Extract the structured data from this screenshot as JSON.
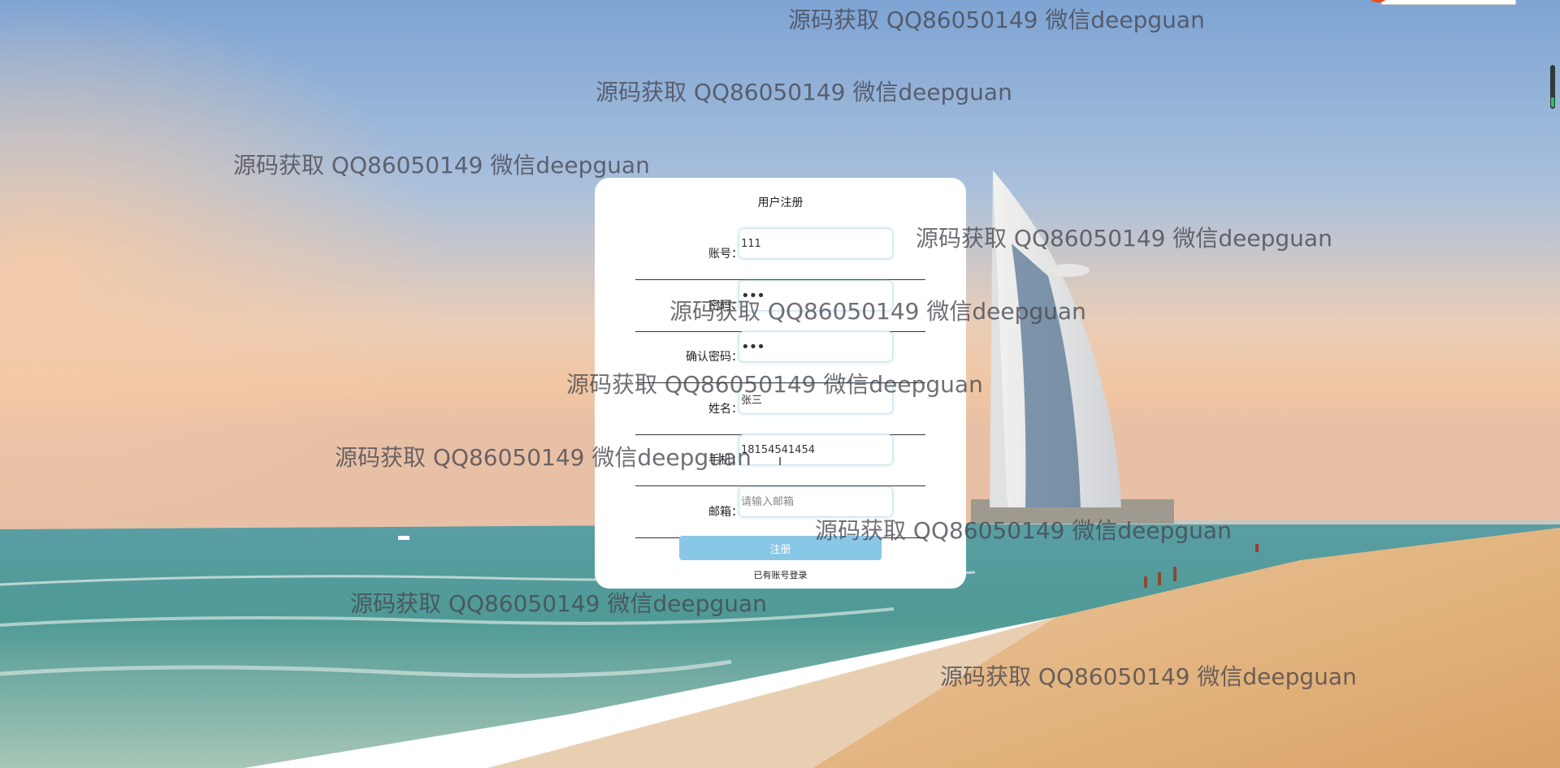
{
  "form": {
    "title": "用户注册",
    "fields": [
      {
        "label": "账号：",
        "value": "111",
        "placeholder": "",
        "type": "text"
      },
      {
        "label": "密码：",
        "value": "111",
        "placeholder": "",
        "type": "password"
      },
      {
        "label": "确认密码：",
        "value": "111",
        "placeholder": "",
        "type": "password"
      },
      {
        "label": "姓名：",
        "value": "张三",
        "placeholder": "",
        "type": "text"
      },
      {
        "label": "手机：",
        "value": "18154541454",
        "placeholder": "",
        "type": "text"
      },
      {
        "label": "邮箱：",
        "value": "",
        "placeholder": "请输入邮箱",
        "type": "text"
      }
    ],
    "submit_label": "注册",
    "login_link": "已有账号登录"
  },
  "watermark": {
    "text": "源码获取 QQ86050149 微信deepguan"
  },
  "colors": {
    "button": "#89c7e6",
    "card": "#ffffff",
    "watermark": "#50505a"
  },
  "icons": {
    "text_cursor": "i-beam-cursor-icon"
  }
}
